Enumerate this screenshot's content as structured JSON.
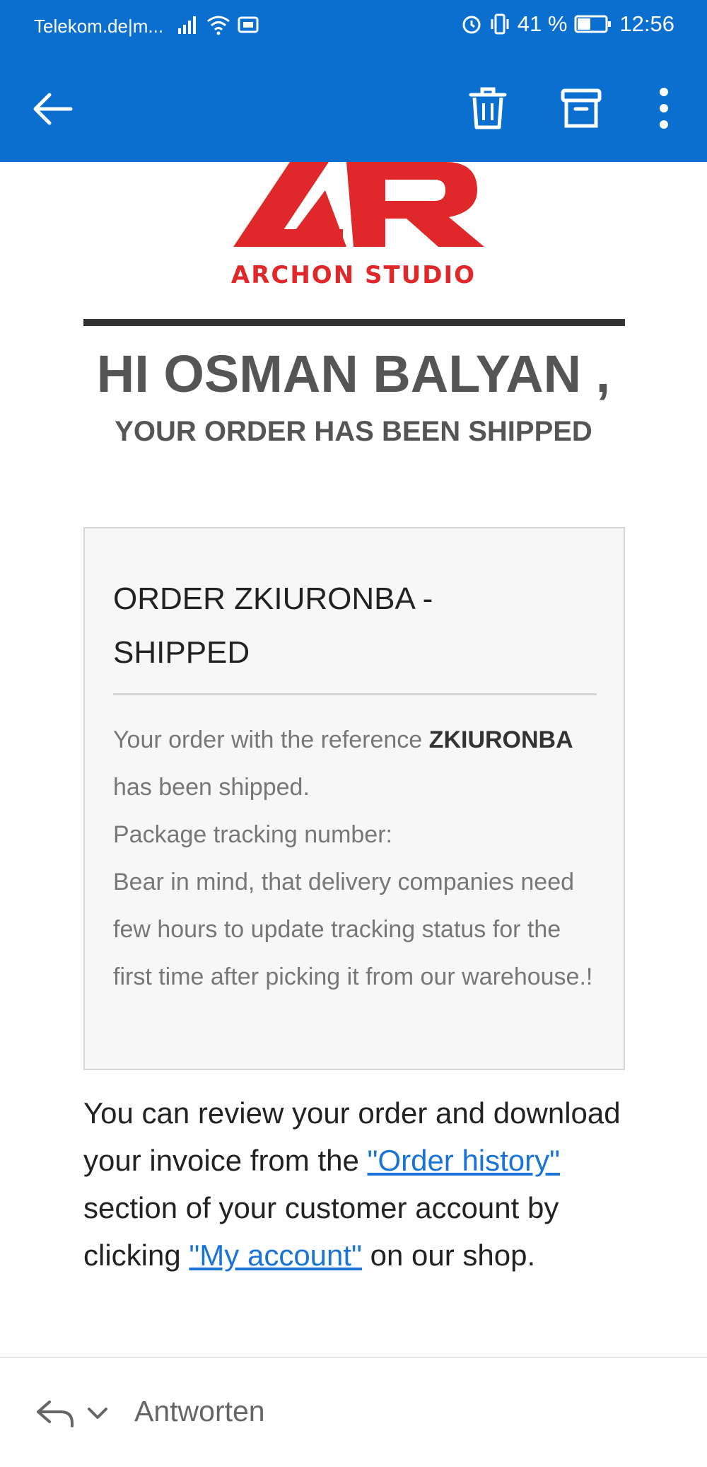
{
  "status_bar": {
    "carrier": "Telekom.de|m...",
    "battery": "41 %",
    "time": "12:56",
    "icons": [
      "signal-icon",
      "wifi-icon",
      "data-icon",
      "alarm-icon",
      "vibrate-icon",
      "battery-icon"
    ]
  },
  "app_bar": {
    "icons": [
      "back-arrow-icon",
      "trash-icon",
      "archive-icon",
      "more-vert-icon"
    ],
    "background_color": "#0a6fcf"
  },
  "email": {
    "logo_text": "ARCHON STUDIO",
    "logo_color": "#e0282b",
    "greeting": "HI OSMAN BALYAN ,",
    "subgreeting": "YOUR ORDER HAS BEEN SHIPPED",
    "order_box": {
      "title_line1": "ORDER ZKIURONBA -",
      "title_line2": "SHIPPED",
      "text_before_ref": "Your order with the reference",
      "reference": "ZKIURONBA",
      "text_after_ref": "has been shipped.",
      "tracking_label": "Package tracking number:",
      "note": "Bear in mind, that delivery companies need few hours to update tracking status for the first time after picking it from our warehouse.!"
    },
    "review": {
      "part1": "You can review your order and download your invoice from the",
      "link1": "\"Order history\"",
      "part2": "section of your customer account by clicking",
      "link2": "\"My account\"",
      "part3": "on our shop."
    }
  },
  "bottom_bar": {
    "reply_label": "Antworten"
  }
}
